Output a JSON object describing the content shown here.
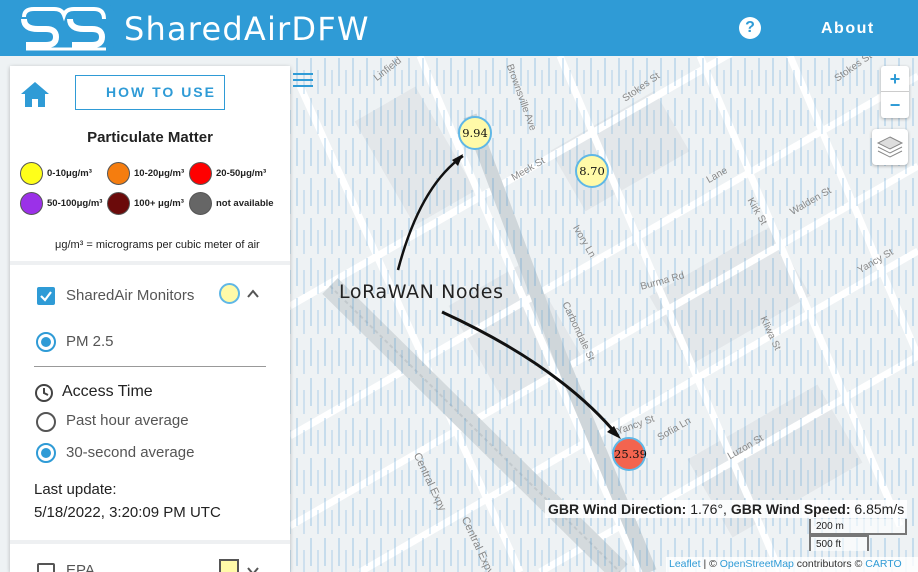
{
  "header": {
    "brand": "SharedAirDFW",
    "help_icon": "question-icon",
    "about_label": "About"
  },
  "sidebar": {
    "howto_label": "HOW TO USE",
    "pm_title": "Particulate Matter",
    "legend": [
      {
        "label": "0-10μg/m³",
        "color": "#ffff1a"
      },
      {
        "label": "10-20μg/m³",
        "color": "#f57d0f"
      },
      {
        "label": "20-50μg/m³",
        "color": "#ff0000"
      },
      {
        "label": "50-100μg/m³",
        "color": "#9b31e8"
      },
      {
        "label": "100+ μg/m³",
        "color": "#6b0a0a"
      },
      {
        "label": "not available",
        "color": "#666666"
      }
    ],
    "units_note": "μg/m³ = micrograms per cubic meter of air",
    "monitors_label": "SharedAir Monitors",
    "pm25_label": "PM 2.5",
    "access_label": "Access Time",
    "past_hour_label": "Past hour average",
    "thirty_sec_label": "30-second average",
    "last_update_label": "Last update:",
    "last_update_value": "5/18/2022, 3:20:09 PM UTC",
    "epa_label": "EPA"
  },
  "map": {
    "markers": [
      {
        "value": "9.94",
        "color": "#fffaa8",
        "ring": "#5fb7e6"
      },
      {
        "value": "8.70",
        "color": "#fffaa8",
        "ring": "#5fb7e6"
      },
      {
        "value": "25.39",
        "color": "#f3644f",
        "ring": "#5fb7e6"
      }
    ],
    "annotation": "LoRaWAN Nodes",
    "wind_dir_label": "GBR Wind Direction:",
    "wind_dir_value": "1.76°,",
    "wind_speed_label": "GBR Wind Speed:",
    "wind_speed_value": "6.85m/s",
    "scale_metric": "200 m",
    "scale_imperial": "500 ft",
    "attribution": {
      "leaflet": "Leaflet",
      "sep": " | © ",
      "osm": "OpenStreetMap",
      "contrib": " contributors © ",
      "carto": "CARTO"
    },
    "streets": [
      "Linfield",
      "Brownsville Ave",
      "Stokes St",
      "Stokes St",
      "Meek St",
      "Ivory Ln",
      "Kirk St",
      "Walden St",
      "Lane",
      "Burma Rd",
      "Carbondale St",
      "Kliwa St",
      "Sofia Ln",
      "Yancy St",
      "Luzon St",
      "Yancy St",
      "Central Expy",
      "Central Expy",
      "Burma Rd",
      "Ivory Ln",
      "Carbondale St",
      "Nyst",
      "Ro"
    ]
  }
}
